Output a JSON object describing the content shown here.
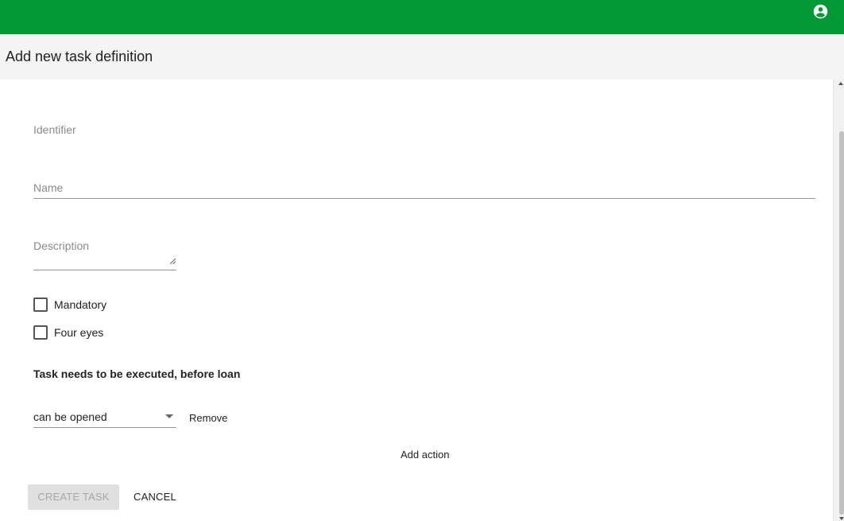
{
  "header": {
    "account_icon": "account-circle-icon",
    "bar_color": "#009933"
  },
  "page": {
    "title": "Add new task definition"
  },
  "form": {
    "identifier_label": "Identifier",
    "name_label": "Name",
    "description_label": "Description",
    "mandatory_label": "Mandatory",
    "four_eyes_label": "Four eyes",
    "mandatory_checked": false,
    "four_eyes_checked": false
  },
  "actions_section": {
    "title": "Task needs to be executed, before loan",
    "action_select_value": "can be opened",
    "remove_label": "Remove",
    "add_action_label": "Add action"
  },
  "buttons": {
    "create_label": "CREATE TASK",
    "cancel_label": "CANCEL"
  }
}
